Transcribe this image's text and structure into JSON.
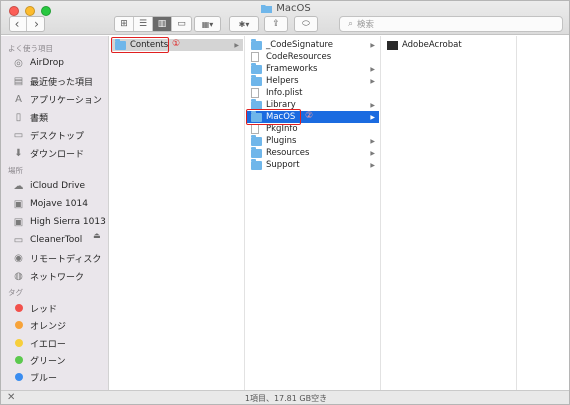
{
  "window": {
    "title": "MacOS"
  },
  "toolbar": {
    "back": "‹",
    "forward": "›",
    "view_icons": [
      "⊞",
      "☰",
      "▥",
      "▭"
    ],
    "group": "▦▾",
    "action": "✱▾",
    "share": "⇪",
    "tag": "⬭",
    "search_placeholder": "検索"
  },
  "sidebar": {
    "favorites_header": "よく使う項目",
    "favorites": [
      {
        "label": "AirDrop",
        "icon": "airdrop-icon",
        "glyph": "◎"
      },
      {
        "label": "最近使った項目",
        "icon": "recents-icon",
        "glyph": "▤"
      },
      {
        "label": "アプリケーション",
        "icon": "applications-icon",
        "glyph": "A"
      },
      {
        "label": "書類",
        "icon": "documents-icon",
        "glyph": "▯"
      },
      {
        "label": "デスクトップ",
        "icon": "desktop-icon",
        "glyph": "▭"
      },
      {
        "label": "ダウンロード",
        "icon": "downloads-icon",
        "glyph": "⬇"
      }
    ],
    "locations_header": "場所",
    "locations": [
      {
        "label": "iCloud Drive",
        "icon": "cloud-icon",
        "glyph": "☁"
      },
      {
        "label": "Mojave 1014",
        "icon": "disk-icon",
        "glyph": "▣"
      },
      {
        "label": "High Sierra 1013",
        "icon": "disk-icon",
        "glyph": "▣"
      },
      {
        "label": "CleanerTool",
        "icon": "disk-icon",
        "glyph": "▭"
      },
      {
        "label": "リモートディスク",
        "icon": "remote-disc-icon",
        "glyph": "◉"
      },
      {
        "label": "ネットワーク",
        "icon": "network-icon",
        "glyph": "◍"
      }
    ],
    "eject": "⏏",
    "tags_header": "タグ",
    "tags": [
      {
        "label": "レッド",
        "color": "#f2514c"
      },
      {
        "label": "オレンジ",
        "color": "#f7a33a"
      },
      {
        "label": "イエロー",
        "color": "#f7cf3b"
      },
      {
        "label": "グリーン",
        "color": "#5cc94e"
      },
      {
        "label": "ブルー",
        "color": "#3b8df0"
      }
    ]
  },
  "columns": {
    "col1": [
      {
        "label": "Contents",
        "type": "folder",
        "arrow": "▶"
      }
    ],
    "col2": [
      {
        "label": "_CodeSignature",
        "type": "folder",
        "arrow": "▶"
      },
      {
        "label": "CodeResources",
        "type": "file",
        "arrow": ""
      },
      {
        "label": "Frameworks",
        "type": "folder",
        "arrow": "▶"
      },
      {
        "label": "Helpers",
        "type": "folder",
        "arrow": "▶"
      },
      {
        "label": "Info.plist",
        "type": "file",
        "arrow": ""
      },
      {
        "label": "Library",
        "type": "folder",
        "arrow": "▶"
      },
      {
        "label": "MacOS",
        "type": "folder",
        "arrow": "▶"
      },
      {
        "label": "PkgInfo",
        "type": "file",
        "arrow": ""
      },
      {
        "label": "Plugins",
        "type": "folder",
        "arrow": "▶"
      },
      {
        "label": "Resources",
        "type": "folder",
        "arrow": "▶"
      },
      {
        "label": "Support",
        "type": "folder",
        "arrow": "▶"
      }
    ],
    "col3": [
      {
        "label": "AdobeAcrobat",
        "type": "exec",
        "arrow": ""
      }
    ]
  },
  "annotations": {
    "one": "①",
    "two": "②"
  },
  "status": {
    "text": "1項目、17.81 GB空き",
    "close": "✕"
  },
  "colors": {
    "selection": "#1b6be0",
    "annotation": "#e02020",
    "folder": "#6fb6ea"
  }
}
